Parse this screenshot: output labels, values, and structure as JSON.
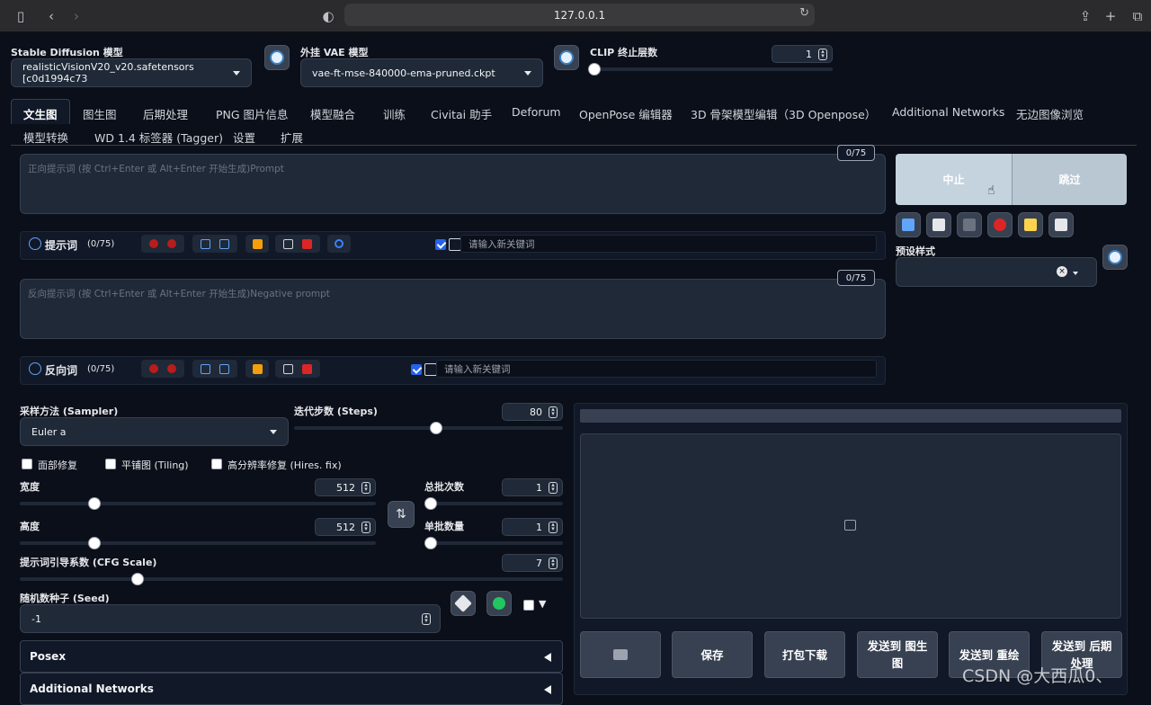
{
  "browser": {
    "url": "127.0.0.1"
  },
  "top": {
    "sd_model_label": "Stable Diffusion 模型",
    "sd_model_value": "realisticVisionV20_v20.safetensors [c0d1994c73",
    "vae_label": "外挂 VAE 模型",
    "vae_value": "vae-ft-mse-840000-ema-pruned.ckpt",
    "clip_label": "CLIP 终止层数",
    "clip_value": "1"
  },
  "tabs_row1": [
    "文生图",
    "图生图",
    "后期处理",
    "PNG 图片信息",
    "模型融合",
    "训练",
    "Civitai 助手",
    "Deforum",
    "OpenPose 编辑器",
    "3D 骨架模型编辑（3D Openpose）",
    "Additional Networks",
    "无边图像浏览"
  ],
  "tabs_row2": [
    "模型转换",
    "WD 1.4 标签器 (Tagger)",
    "设置",
    "扩展"
  ],
  "prompt": {
    "placeholder": "正向提示词 (按 Ctrl+Enter 或 Alt+Enter 开始生成)Prompt",
    "counter": "0/75",
    "section_label": "提示词",
    "section_count": "(0/75)",
    "keyword_placeholder": "请输入新关键词"
  },
  "negative": {
    "placeholder": "反向提示词 (按 Ctrl+Enter 或 Alt+Enter 开始生成)Negative prompt",
    "counter": "0/75",
    "section_label": "反向词",
    "section_count": "(0/75)",
    "keyword_placeholder": "请输入新关键词"
  },
  "actions": {
    "interrupt": "中止",
    "skip": "跳过",
    "preset_label": "预设样式"
  },
  "params": {
    "sampler_label": "采样方法 (Sampler)",
    "sampler_value": "Euler a",
    "steps_label": "迭代步数 (Steps)",
    "steps_value": "80",
    "steps_fraction": 0.53,
    "face_restore": "面部修复",
    "tiling": "平铺图 (Tiling)",
    "hires_fix": "高分辨率修复 (Hires. fix)",
    "width_label": "宽度",
    "width_value": "512",
    "width_fraction": 0.2,
    "height_label": "高度",
    "height_value": "512",
    "height_fraction": 0.2,
    "batch_count_label": "总批次数",
    "batch_count_value": "1",
    "batch_size_label": "单批数量",
    "batch_size_value": "1",
    "cfg_label": "提示词引导系数 (CFG Scale)",
    "cfg_value": "7",
    "cfg_fraction": 0.21,
    "seed_label": "随机数种子 (Seed)",
    "seed_value": "-1"
  },
  "accordions": [
    "Posex",
    "Additional Networks"
  ],
  "output_buttons": [
    "保存",
    "打包下载",
    "发送到 图生图",
    "发送到 重绘",
    "发送到 后期处理"
  ],
  "watermark": "CSDN @大西瓜0、"
}
